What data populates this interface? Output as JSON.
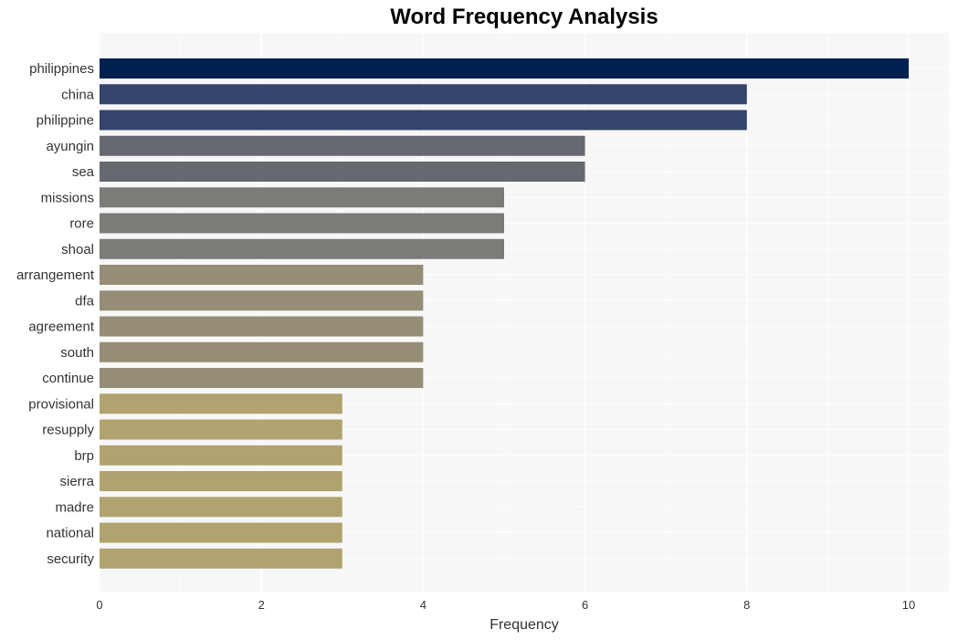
{
  "chart_data": {
    "type": "bar",
    "orientation": "horizontal",
    "title": "Word Frequency Analysis",
    "xlabel": "Frequency",
    "ylabel": "",
    "xlim": [
      0,
      10.5
    ],
    "xticks": [
      0,
      2,
      4,
      6,
      8,
      10
    ],
    "grid": true,
    "categories": [
      "philippines",
      "china",
      "philippine",
      "ayungin",
      "sea",
      "missions",
      "rore",
      "shoal",
      "arrangement",
      "dfa",
      "agreement",
      "south",
      "continue",
      "provisional",
      "resupply",
      "brp",
      "sierra",
      "madre",
      "national",
      "security"
    ],
    "values": [
      10,
      8,
      8,
      6,
      6,
      5,
      5,
      5,
      4,
      4,
      4,
      4,
      4,
      3,
      3,
      3,
      3,
      3,
      3,
      3
    ],
    "colors": {
      "10": "#00204f",
      "8": "#34446a",
      "6": "#676970",
      "5": "#7c7b78",
      "4": "#958d75",
      "3": "#b0a370"
    },
    "background": "#f7f7f7"
  }
}
